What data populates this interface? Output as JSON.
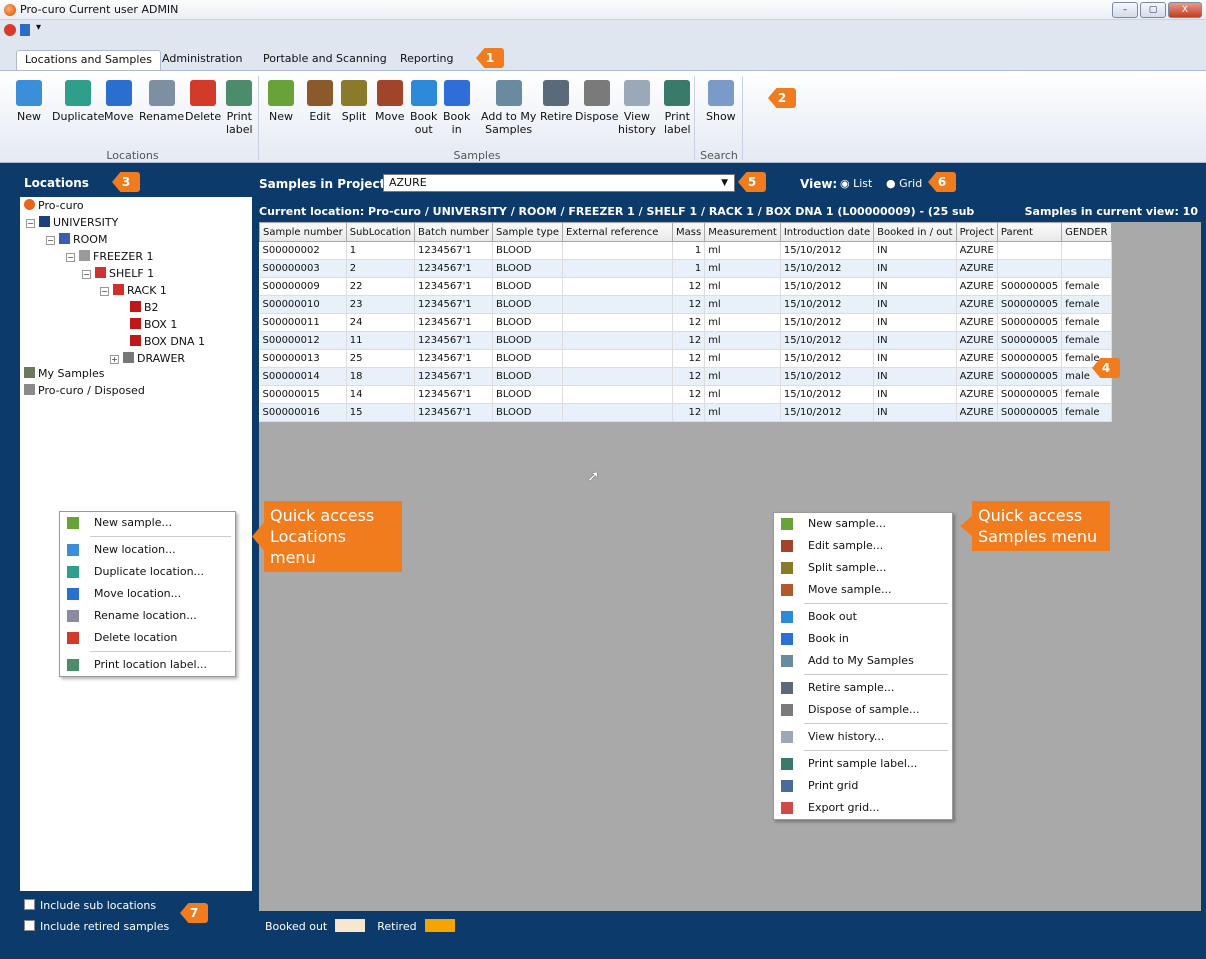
{
  "window": {
    "title": "Pro-curo  Current user ADMIN",
    "minimize": "–",
    "maximize": "▢",
    "close": "X"
  },
  "tabs": [
    "Locations and Samples",
    "Administration",
    "Portable and Scanning",
    "Reporting"
  ],
  "ribbon": {
    "locations": [
      {
        "label": "New"
      },
      {
        "label": "Duplicate"
      },
      {
        "label": "Move"
      },
      {
        "label": "Rename"
      },
      {
        "label": "Delete"
      },
      {
        "label": "Print\nlabel"
      }
    ],
    "samples": [
      {
        "label": "New"
      },
      {
        "label": "Edit"
      },
      {
        "label": "Split"
      },
      {
        "label": "Move"
      },
      {
        "label": "Book\nout"
      },
      {
        "label": "Book\nin"
      },
      {
        "label": "Add to My\nSamples"
      },
      {
        "label": "Retire"
      },
      {
        "label": "Dispose"
      },
      {
        "label": "View\nhistory"
      },
      {
        "label": "Print\nlabel"
      }
    ],
    "search": [
      {
        "label": "Show"
      }
    ],
    "groups": {
      "locations": "Locations",
      "samples": "Samples",
      "search": "Search"
    }
  },
  "badges": [
    "1",
    "2",
    "3",
    "4",
    "5",
    "6",
    "7"
  ],
  "locations": {
    "title": "Locations",
    "tree": [
      {
        "label": "Pro-curo",
        "exp": ""
      },
      {
        "label": "UNIVERSITY",
        "exp": "−"
      },
      {
        "label": "ROOM",
        "exp": "−"
      },
      {
        "label": "FREEZER 1",
        "exp": "−"
      },
      {
        "label": "SHELF 1",
        "exp": "−"
      },
      {
        "label": "RACK 1",
        "exp": "−"
      },
      {
        "label": "B2",
        "exp": ""
      },
      {
        "label": "BOX 1",
        "exp": ""
      },
      {
        "label": "BOX DNA 1",
        "exp": ""
      },
      {
        "label": "DRAWER",
        "exp": "+"
      },
      {
        "label": "My Samples",
        "exp": ""
      },
      {
        "label": "Pro-curo / Disposed",
        "exp": ""
      }
    ],
    "include_sub": "Include sub locations",
    "include_retired": "Include retired samples"
  },
  "samples": {
    "project_label": "Samples in Project:",
    "project": "AZURE",
    "view_label": "View:",
    "view_list": "List",
    "view_grid": "Grid",
    "current_location": "Current location: Pro-curo / UNIVERSITY / ROOM / FREEZER 1 / SHELF 1 / RACK 1 / BOX DNA 1  (L00000009)  -  (25 sub",
    "count": "Samples in current view: 10",
    "columns": [
      "Sample number",
      "SubLocation",
      "Batch number",
      "Sample type",
      "External reference",
      "Mass",
      "Measurement",
      "Introduction date",
      "Booked in / out",
      "Project",
      "Parent",
      "GENDER"
    ],
    "rows": [
      [
        "S00000002",
        "1",
        "1234567'1",
        "BLOOD",
        "",
        "1",
        "ml",
        "15/10/2012",
        "IN",
        "AZURE",
        "",
        ""
      ],
      [
        "S00000003",
        "2",
        "1234567'1",
        "BLOOD",
        "",
        "1",
        "ml",
        "15/10/2012",
        "IN",
        "AZURE",
        "",
        ""
      ],
      [
        "S00000009",
        "22",
        "1234567'1",
        "BLOOD",
        "",
        "12",
        "ml",
        "15/10/2012",
        "IN",
        "AZURE",
        "S00000005",
        "female"
      ],
      [
        "S00000010",
        "23",
        "1234567'1",
        "BLOOD",
        "",
        "12",
        "ml",
        "15/10/2012",
        "IN",
        "AZURE",
        "S00000005",
        "female"
      ],
      [
        "S00000011",
        "24",
        "1234567'1",
        "BLOOD",
        "",
        "12",
        "ml",
        "15/10/2012",
        "IN",
        "AZURE",
        "S00000005",
        "female"
      ],
      [
        "S00000012",
        "11",
        "1234567'1",
        "BLOOD",
        "",
        "12",
        "ml",
        "15/10/2012",
        "IN",
        "AZURE",
        "S00000005",
        "female"
      ],
      [
        "S00000013",
        "25",
        "1234567'1",
        "BLOOD",
        "",
        "12",
        "ml",
        "15/10/2012",
        "IN",
        "AZURE",
        "S00000005",
        "female"
      ],
      [
        "S00000014",
        "18",
        "1234567'1",
        "BLOOD",
        "",
        "12",
        "ml",
        "15/10/2012",
        "IN",
        "AZURE",
        "S00000005",
        "male"
      ],
      [
        "S00000015",
        "14",
        "1234567'1",
        "BLOOD",
        "",
        "12",
        "ml",
        "15/10/2012",
        "IN",
        "AZURE",
        "S00000005",
        "female"
      ],
      [
        "S00000016",
        "15",
        "1234567'1",
        "BLOOD",
        "",
        "12",
        "ml",
        "15/10/2012",
        "IN",
        "AZURE",
        "S00000005",
        "female"
      ]
    ]
  },
  "loc_menu": {
    "callout1": "Quick access",
    "callout2": "Locations menu",
    "items": [
      "New sample...",
      "-",
      "New location...",
      "Duplicate location...",
      "Move location...",
      "Rename location...",
      "Delete location",
      "-",
      "Print location label..."
    ]
  },
  "sample_menu": {
    "callout1": "Quick access",
    "callout2": "Samples menu",
    "items": [
      "New sample...",
      "Edit sample...",
      "Split sample...",
      "Move sample...",
      "-",
      "Book out",
      "Book in",
      "Add to My Samples",
      "-",
      "Retire sample...",
      "Dispose of sample...",
      "-",
      "View history...",
      "-",
      "Print sample label...",
      "Print grid",
      "Export grid..."
    ]
  },
  "legend": {
    "booked_out": "Booked out",
    "retired": "Retired",
    "booked_out_color": "#f8e6cf",
    "retired_color": "#f5a400"
  }
}
